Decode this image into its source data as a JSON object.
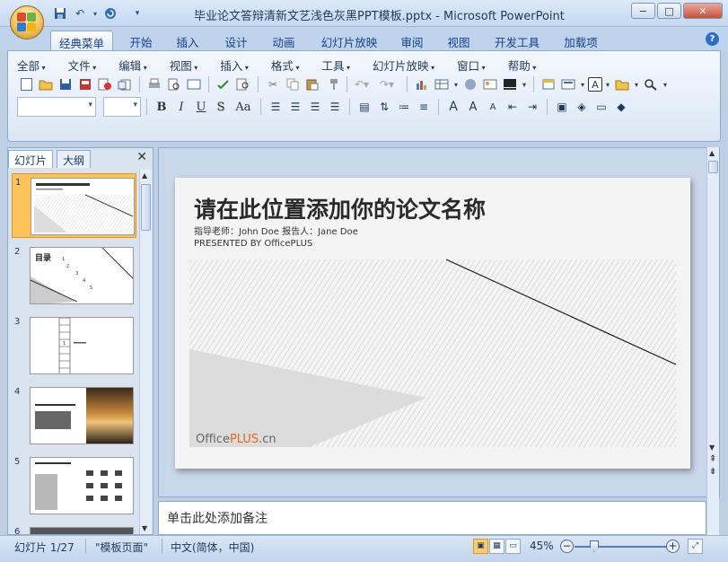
{
  "window": {
    "title": "毕业论文答辩清新文艺浅色灰黑PPT模板.pptx - Microsoft PowerPoint",
    "min": "−",
    "max": "□",
    "close": "✕"
  },
  "ribbon_tabs": [
    "经典菜单",
    "开始",
    "插入",
    "设计",
    "动画",
    "幻灯片放映",
    "审阅",
    "视图",
    "开发工具",
    "加载项"
  ],
  "menu": [
    "全部",
    "文件",
    "编辑",
    "视图",
    "插入",
    "格式",
    "工具",
    "幻灯片放映",
    "窗口",
    "帮助"
  ],
  "format_buttons": {
    "bold": "B",
    "italic": "I",
    "underline": "U",
    "shadow": "S",
    "case": "Aa"
  },
  "panel": {
    "tab_slides": "幻灯片",
    "tab_outline": "大纲",
    "close": "✕"
  },
  "thumbnails": [
    {
      "n": "1",
      "selected": true
    },
    {
      "n": "2"
    },
    {
      "n": "3"
    },
    {
      "n": "4"
    },
    {
      "n": "5"
    },
    {
      "n": "6"
    }
  ],
  "slide": {
    "title": "请在此位置添加你的论文名称",
    "subtitle": "指导老师：John Doe   报告人：Jane Doe",
    "presented": "PRESENTED BY OfficePLUS",
    "logo_a": "Office",
    "logo_b": "PLUS",
    "logo_c": ".cn"
  },
  "thumb2_title": "目录",
  "notes_placeholder": "单击此处添加备注",
  "status": {
    "slide": "幻灯片 1/27",
    "theme": "\"模板页面\"",
    "lang": "中文(简体，中国)",
    "zoom": "45%"
  }
}
